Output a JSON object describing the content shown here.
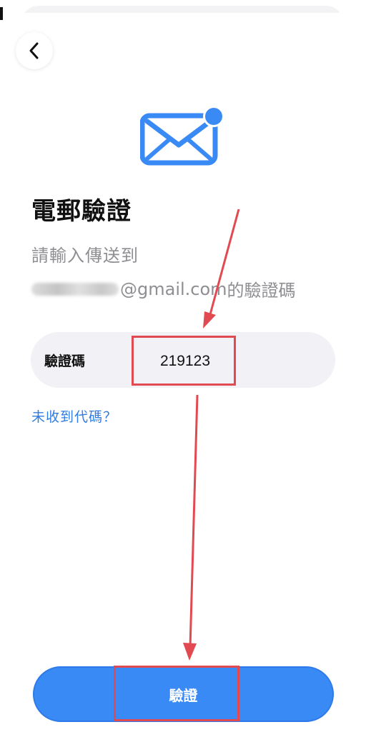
{
  "header": {
    "back_icon": "chevron-left-icon"
  },
  "hero": {
    "icon": "mail-notification-icon",
    "icon_color": "#3a8af5"
  },
  "content": {
    "title": "電郵驗證",
    "subtitle_line1": "請輸入傳送到",
    "email_suffix": "@gmail.com",
    "subtitle_tail": " 的驗證碼"
  },
  "code_field": {
    "label": "驗證碼",
    "value": "219123"
  },
  "resend": {
    "label": "未收到代碼？"
  },
  "footer": {
    "verify_label": "驗證",
    "button_color": "#3a8af5"
  },
  "annotations": {
    "highlight_color": "#e24a52"
  }
}
